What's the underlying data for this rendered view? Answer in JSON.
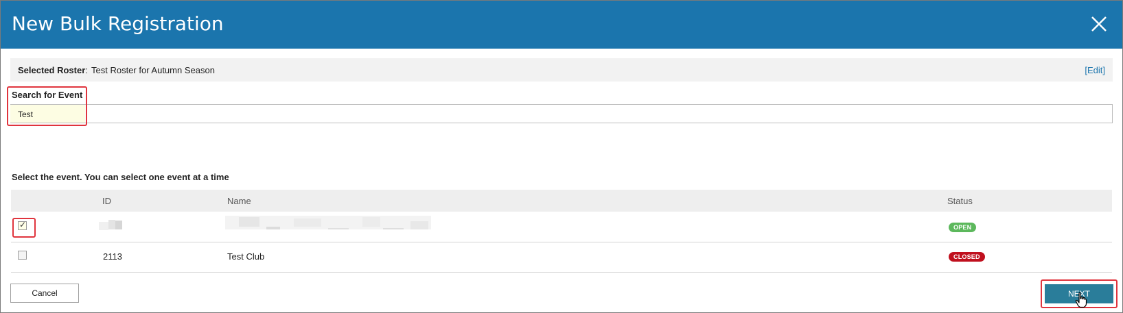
{
  "dialog": {
    "title": "New Bulk Registration"
  },
  "roster": {
    "label": "Selected Roster",
    "colon": ":",
    "value": "Test Roster for Autumn Season",
    "edit_link": "[Edit]"
  },
  "search": {
    "label": "Search for Event",
    "value": "Test"
  },
  "instruction": "Select the event. You can select one event at a time",
  "table": {
    "columns": {
      "id": "ID",
      "name": "Name",
      "status": "Status"
    },
    "rows": [
      {
        "checked": true,
        "id": "",
        "name": "",
        "status": "OPEN",
        "status_color": "#5cb85c"
      },
      {
        "checked": false,
        "id": "2113",
        "name": "Test Club",
        "status": "CLOSED",
        "status_color": "#c0101e"
      }
    ]
  },
  "footer": {
    "cancel_label": "Cancel",
    "next_label": "NEXT"
  },
  "colors": {
    "header": "#1b75ad",
    "next_button": "#2a7d9a",
    "highlight_outline": "#e0343d",
    "link": "#1b75ad"
  },
  "icons": {
    "close": "close-icon",
    "cursor": "hand-cursor-icon",
    "check": "checkmark-icon"
  }
}
